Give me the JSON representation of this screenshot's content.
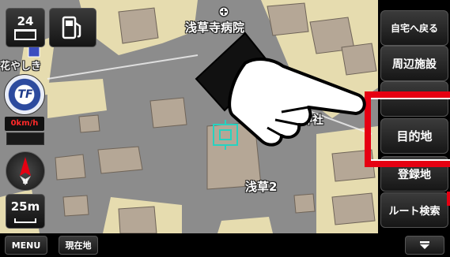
{
  "map": {
    "labels": {
      "hospital": "浅草寺病院",
      "shrine": "浅草神社",
      "asakusa2": "浅草2",
      "yashiki": "花やしき"
    },
    "colors": {
      "road": "#8c8c8c",
      "block": "#e6dcaf",
      "building": "#b5a796",
      "highlight": "#e60012"
    }
  },
  "left_panel": {
    "button_24": {
      "number": "24",
      "icon": "calendar-24-icon"
    },
    "fuel_icon": "fuel-pump-icon",
    "emblem_text": "TF",
    "speed_text": "0km/h",
    "compass": {
      "label": "N",
      "icon": "compass-icon"
    },
    "scale": "25m"
  },
  "right_menu": {
    "home": "自宅へ戻る",
    "nearby": "周辺施設",
    "middle": "",
    "destination": "目的地",
    "registered": "登録地",
    "route_search": "ルート検索"
  },
  "bottom_bar": {
    "menu": "MENU",
    "current_location": "現在地",
    "collapse_icon": "chevron-down-icon"
  }
}
